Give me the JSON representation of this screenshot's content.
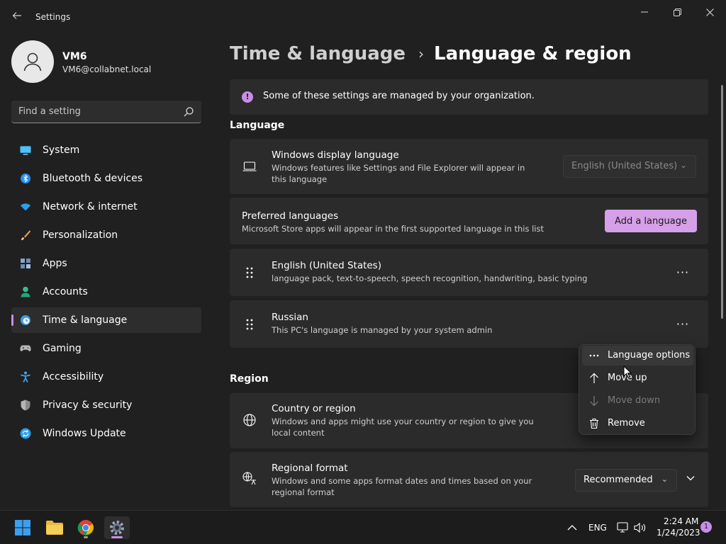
{
  "window": {
    "title": "Settings",
    "back_icon": "arrow-left-icon",
    "minimize_icon": "minimize-icon",
    "maximize_icon": "restore-icon",
    "close_icon": "close-icon"
  },
  "profile": {
    "name": "VM6",
    "email": "VM6@collabnet.local",
    "avatar_icon": "user-icon"
  },
  "search": {
    "placeholder": "Find a setting",
    "icon": "search-icon"
  },
  "sidebar": {
    "accent": "#c98de8",
    "items": [
      {
        "label": "System",
        "icon": "monitor-icon",
        "active": false
      },
      {
        "label": "Bluetooth & devices",
        "icon": "bluetooth-icon",
        "active": false
      },
      {
        "label": "Network & internet",
        "icon": "wifi-icon",
        "active": false
      },
      {
        "label": "Personalization",
        "icon": "brush-icon",
        "active": false
      },
      {
        "label": "Apps",
        "icon": "apps-icon",
        "active": false
      },
      {
        "label": "Accounts",
        "icon": "person-icon",
        "active": false
      },
      {
        "label": "Time & language",
        "icon": "clock-globe-icon",
        "active": true
      },
      {
        "label": "Gaming",
        "icon": "gamepad-icon",
        "active": false
      },
      {
        "label": "Accessibility",
        "icon": "accessibility-icon",
        "active": false
      },
      {
        "label": "Privacy & security",
        "icon": "shield-icon",
        "active": false
      },
      {
        "label": "Windows Update",
        "icon": "update-icon",
        "active": false
      }
    ]
  },
  "breadcrumb": {
    "parent": "Time & language",
    "separator": "›",
    "current": "Language & region"
  },
  "info_bar": {
    "icon": "info-icon",
    "text": "Some of these settings are managed by your organization."
  },
  "language_section": {
    "heading": "Language",
    "display_language": {
      "icon": "laptop-icon",
      "title": "Windows display language",
      "description": "Windows features like Settings and File Explorer will appear in this language",
      "value": "English (United States)",
      "disabled": true
    },
    "preferred": {
      "title": "Preferred languages",
      "description": "Microsoft Store apps will appear in the first supported language in this list",
      "button_label": "Add a language"
    },
    "languages": [
      {
        "name": "English (United States)",
        "detail": "language pack, text-to-speech, speech recognition, handwriting, basic typing"
      },
      {
        "name": "Russian",
        "detail": "This PC's language is managed by your system admin"
      }
    ],
    "more_glyph": "···"
  },
  "context_menu": {
    "items": [
      {
        "label": "Language options",
        "icon": "more-horizontal-icon",
        "disabled": false,
        "hovered": true
      },
      {
        "label": "Move up",
        "icon": "arrow-up-icon",
        "disabled": false,
        "hovered": false
      },
      {
        "label": "Move down",
        "icon": "arrow-down-icon",
        "disabled": true,
        "hovered": false
      },
      {
        "label": "Remove",
        "icon": "trash-icon",
        "disabled": false,
        "hovered": false
      }
    ]
  },
  "region_section": {
    "heading": "Region",
    "country": {
      "icon": "globe-icon",
      "title": "Country or region",
      "description": "Windows and apps might use your country or region to give you local content"
    },
    "format": {
      "icon": "regional-format-icon",
      "title": "Regional format",
      "description": "Windows and some apps format dates and times based on your regional format",
      "value": "Recommended"
    }
  },
  "taskbar": {
    "apps": [
      {
        "name": "start",
        "icon": "windows-logo-icon"
      },
      {
        "name": "file-explorer",
        "icon": "folder-icon"
      },
      {
        "name": "chrome",
        "icon": "chrome-icon"
      },
      {
        "name": "settings",
        "icon": "gear-icon"
      }
    ],
    "tray": {
      "chevron_icon": "chevron-up-icon",
      "language": "ENG",
      "network_icon": "network-icon",
      "volume_icon": "volume-icon",
      "time": "2:24 AM",
      "date": "1/24/2023",
      "notifications": "1"
    }
  }
}
